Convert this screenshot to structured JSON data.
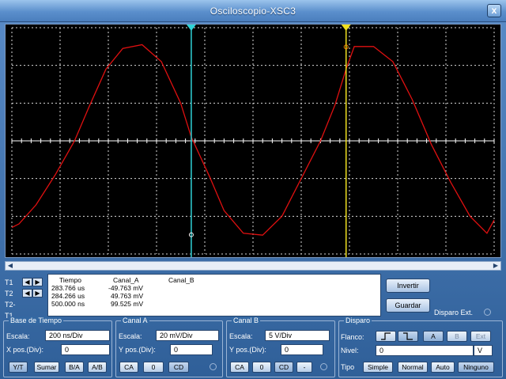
{
  "window": {
    "title": "Osciloscopio-XSC3",
    "close_label": "x"
  },
  "cursors": {
    "labels": [
      "T1",
      "T2",
      "T2-T1"
    ],
    "t1_position_div": 3.72,
    "t2_position_div": 6.93,
    "t1_color": "#2fd3d8",
    "t2_color": "#f0e020"
  },
  "readout": {
    "headers": [
      "Tiempo",
      "Canal_A",
      "Canal_B"
    ],
    "rows": [
      {
        "label": "T1",
        "tiempo": "283.766 us",
        "canal_a": "-49.763 mV",
        "canal_b": ""
      },
      {
        "label": "T2",
        "tiempo": "284.266 us",
        "canal_a": "49.763 mV",
        "canal_b": ""
      },
      {
        "label": "T2-T1",
        "tiempo": "500.000 ns",
        "canal_a": "99.525 mV",
        "canal_b": ""
      }
    ]
  },
  "actions": {
    "invert_label": "Invertir",
    "save_label": "Guardar",
    "ext_trigger_label": "Disparo Ext."
  },
  "timebase": {
    "legend": "Base de Tiempo",
    "scale_label": "Escala:",
    "scale_value": "200 ns/Div",
    "xpos_label": "X pos.(Div):",
    "xpos_value": "0",
    "modes": [
      "Y/T",
      "Sumar",
      "B/A",
      "A/B"
    ],
    "active_mode": "Y/T"
  },
  "channel_a": {
    "legend": "Canal A",
    "scale_label": "Escala:",
    "scale_value": "20 mV/Div",
    "ypos_label": "Y pos.(Div):",
    "ypos_value": "0",
    "coupling": [
      "CA",
      "0",
      "CD"
    ],
    "active_coupling": "CD",
    "color": "#e01010"
  },
  "channel_b": {
    "legend": "Canal B",
    "scale_label": "Escala:",
    "scale_value": "5  V/Div",
    "ypos_label": "Y pos.(Div):",
    "ypos_value": "0",
    "coupling": [
      "CA",
      "0",
      "CD",
      "-"
    ],
    "active_coupling": "CD"
  },
  "trigger": {
    "legend": "Disparo",
    "edge_label": "Flanco:",
    "edges": [
      "rising-edge",
      "falling-edge"
    ],
    "sources": [
      "A",
      "B",
      "Ext"
    ],
    "active_source": "A",
    "level_label": "Nivel:",
    "level_value": "0",
    "level_unit": "V",
    "type_label": "Tipo",
    "types": [
      "Simple",
      "Normal",
      "Auto",
      "Ninguno"
    ],
    "active_type": "Ninguno"
  },
  "chart_data": {
    "type": "line",
    "title": "",
    "xlabel": "",
    "ylabel": "",
    "grid": true,
    "x_divisions": 10,
    "y_divisions": 6,
    "x_range_div": [
      0,
      10
    ],
    "y_range_div": [
      -3,
      3
    ],
    "series": [
      {
        "x": [
          0,
          0.15,
          0.5,
          0.9,
          1.3,
          1.6,
          1.95,
          2.3,
          2.7,
          3.1,
          3.5,
          3.72,
          4.1,
          4.4,
          4.8,
          5.2,
          5.6,
          6.0,
          6.4,
          6.7,
          6.93,
          7.1,
          7.5,
          7.9,
          8.3,
          8.7,
          9.1,
          9.5,
          9.85,
          10
        ],
        "y": [
          -2.3,
          -2.2,
          -1.7,
          -0.9,
          0,
          0.9,
          1.9,
          2.45,
          2.55,
          2.1,
          1.0,
          0.1,
          -0.95,
          -1.85,
          -2.45,
          -2.5,
          -2.0,
          -1.0,
          0,
          0.95,
          1.9,
          2.5,
          2.5,
          2.1,
          1.1,
          -0.1,
          -1.1,
          -2.0,
          -2.45,
          -2.1
        ]
      }
    ],
    "cursor_points": [
      {
        "cursor": "T1",
        "x_div": 3.72,
        "y_div": -2.49
      },
      {
        "cursor": "T2",
        "x_div": 6.93,
        "y_div": 2.49
      }
    ]
  }
}
